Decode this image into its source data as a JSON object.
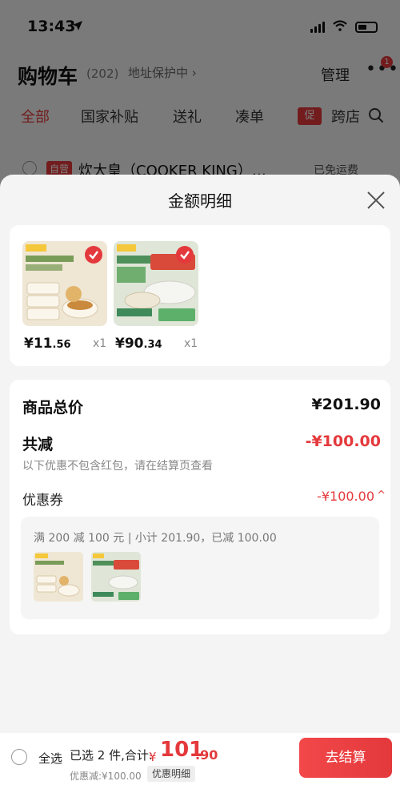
{
  "status_bar": {
    "time": "13:43",
    "location_icon": "location-arrow-icon",
    "signal_icon": "signal-icon",
    "wifi_icon": "wifi-icon",
    "battery_icon": "battery-icon"
  },
  "cart_header": {
    "title": "购物车",
    "count": "(202)",
    "address_protect": "地址保护中 ›",
    "manage": "管理",
    "more_badge": "1"
  },
  "cart_tabs": [
    "全部",
    "国家补贴",
    "送礼",
    "凑单",
    "跨店"
  ],
  "promo_tag": "促",
  "store": {
    "self_tag": "自营",
    "name": "炊大皇（COOKER KING）…",
    "shipping": "已免运费"
  },
  "sheet": {
    "title": "金额明细",
    "products": [
      {
        "price_int": "¥11",
        "price_dec": ".56",
        "qty": "x1"
      },
      {
        "price_int": "¥90",
        "price_dec": ".34",
        "qty": "x1"
      }
    ],
    "summary": {
      "total_label": "商品总价",
      "total_value": "¥201.90",
      "reduce_label": "共减",
      "reduce_value": "-¥100.00",
      "note": "以下优惠不包含红包，请在结算页查看",
      "coupon_label": "优惠券",
      "coupon_value": "-¥100.00",
      "coupon_desc": "满 200 减 100 元 | 小计 201.90，已减 100.00"
    }
  },
  "bottom_bar": {
    "select_all": "全选",
    "selected_text": "已选 2 件,合计:",
    "currency": "¥",
    "total_int": "101",
    "total_dec": ".90",
    "discount_text": "优惠减:¥100.00",
    "detail_link": "优惠明细",
    "checkout": "去结算"
  },
  "colors": {
    "accent": "#e4393c",
    "dim_overlay": "rgba(0,0,0,0.5)",
    "sheet_bg": "#f4f4f4"
  }
}
